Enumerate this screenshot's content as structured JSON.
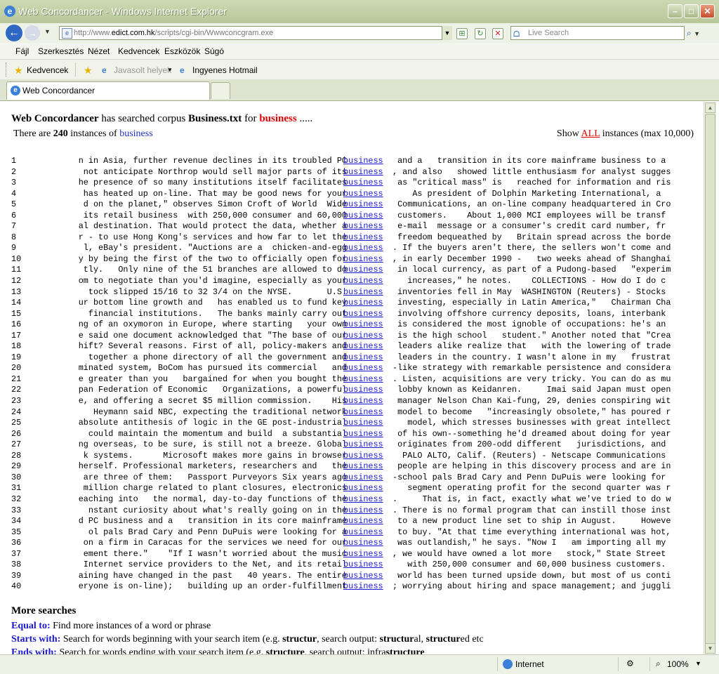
{
  "window": {
    "title": "Web Concordancer - Windows Internet Explorer"
  },
  "nav": {
    "url_prefix": "http://www.",
    "url_host": "edict.com.hk",
    "url_path": "/scripts/cgi-bin/Wwwconcgram.exe",
    "search_placeholder": "Live Search"
  },
  "menu": [
    "Fájl",
    "Szerkesztés",
    "Nézet",
    "Kedvencek",
    "Eszközök",
    "Súgó"
  ],
  "favorites": {
    "label": "Kedvencek",
    "suggested": "Javasolt helyek",
    "hotmail": "Ingyenes Hotmail"
  },
  "tab": {
    "label": "Web Concordancer"
  },
  "page": {
    "h_app": "Web Concordancer",
    "h_text1": " has searched corpus ",
    "h_corpus": "Business.txt",
    "h_text2": " for ",
    "h_term": "business",
    "h_dots": " .....",
    "count_pre": "There are ",
    "count_num": "240",
    "count_mid": " instances of ",
    "count_term": "business",
    "show_pre": "Show ",
    "show_all": "ALL",
    "show_post": " instances (max 10,000)"
  },
  "concordance": [
    {
      "n": "1",
      "left": "n in Asia, further revenue declines in its troubled PC",
      "kw": "business",
      "right": " and a   transition in its core mainframe business to a"
    },
    {
      "n": "2",
      "left": "not anticipate Northrop would sell major parts of its",
      "kw": "business",
      "right": ", and also   showed little enthusiasm for analyst sugges"
    },
    {
      "n": "3",
      "left": "he presence of so many institutions itself facilitates",
      "kw": "business",
      "right": " as \"critical mass\" is   reached for information and ris"
    },
    {
      "n": "4",
      "left": "has heated up on-line. That may be good news for your",
      "kw": "business",
      "right": "    As president of Dolphin Marketing International, a"
    },
    {
      "n": "5",
      "left": "d on the planet,\" observes Simon Croft of World  Wide",
      "kw": "business",
      "right": " Communications, an on-line company headquartered in Cro"
    },
    {
      "n": "6",
      "left": "its retail business  with 250,000 consumer and 60,000",
      "kw": "business",
      "right": " customers.    About 1,000 MCI employees will be transf"
    },
    {
      "n": "7",
      "left": "al destination. That would protect the data, whether a",
      "kw": "business",
      "right": " e-mail  message or a consumer's credit card number, fr"
    },
    {
      "n": "8",
      "left": "r - to use Hong Kong's services and how far to let the",
      "kw": "business",
      "right": " freedom bequeathed by   Britain spread across the borde"
    },
    {
      "n": "9",
      "left": "l, eBay's president. \"Auctions are a  chicken-and-egg",
      "kw": "business",
      "right": ". If the buyers aren't there, the sellers won't come and"
    },
    {
      "n": "10",
      "left": "y by being the first of the two to officially open for",
      "kw": "business",
      "right": ", in early December 1990 -   two weeks ahead of Shanghai"
    },
    {
      "n": "11",
      "left": "tly.   Only nine of the 51 branches are allowed to do",
      "kw": "business",
      "right": " in local currency, as part of a Pudong-based   \"experim"
    },
    {
      "n": "12",
      "left": "om to negotiate than you'd imagine, especially as your",
      "kw": "business",
      "right": "   increases,\" he notes.    COLLECTIONS - How do I do c"
    },
    {
      "n": "13",
      "left": "tock slipped 15/16 to 32 3/4 on the NYSE.       U.S.",
      "kw": "business",
      "right": " inventories fell in May  WASHINGTON (Reuters) - Stocks"
    },
    {
      "n": "14",
      "left": "ur bottom line growth and   has enabled us to fund key",
      "kw": "business",
      "right": " investing, especially in Latin America,\"   Chairman Cha"
    },
    {
      "n": "15",
      "left": "financial institutions.   The banks mainly carry out",
      "kw": "business",
      "right": " involving offshore currency deposits, loans, interbank"
    },
    {
      "n": "16",
      "left": "ng of an oxymoron in Europe, where starting   your own",
      "kw": "business",
      "right": " is considered the most ignoble of occupations: he's an"
    },
    {
      "n": "17",
      "left": "e said one document acknowledged that \"The base of our",
      "kw": "business",
      "right": " is the high school   student.\" Another noted that \"Crea"
    },
    {
      "n": "18",
      "left": "hift? Several reasons. First of all, policy-makers and",
      "kw": "business",
      "right": " leaders alike realize that   with the lowering of trade"
    },
    {
      "n": "19",
      "left": "together a phone directory of all the government and",
      "kw": "business",
      "right": " leaders in the country. I wasn't alone in my   frustrat"
    },
    {
      "n": "20",
      "left": "minated system, BoCom has pursued its commercial   and",
      "kw": "business",
      "right": "-like strategy with remarkable persistence and considera"
    },
    {
      "n": "21",
      "left": "e greater than you   bargained for when you bought the",
      "kw": "business",
      "right": ". Listen, acquisitions are very tricky. You can do as mu"
    },
    {
      "n": "22",
      "left": "pan Federation of Economic   Organizations, a powerful",
      "kw": "business",
      "right": " lobby known as Keidanren.     Imai said Japan must open"
    },
    {
      "n": "23",
      "left": "e, and offering a secret $5 million commission.    His",
      "kw": "business",
      "right": " manager Nelson Chan Kai-fung, 29, denies conspiring wit"
    },
    {
      "n": "24",
      "left": "Heymann said NBC, expecting the traditional network",
      "kw": "business",
      "right": " model to become   \"increasingly obsolete,\" has poured r"
    },
    {
      "n": "25",
      "left": "absolute antithesis of logic in the GE post-industrial",
      "kw": "business",
      "right": "   model, which stresses businesses with great intellect"
    },
    {
      "n": "26",
      "left": "could maintain the momentum and build  a substantial",
      "kw": "business",
      "right": " of his own--something he'd dreamed about doing for year"
    },
    {
      "n": "27",
      "left": "ng overseas, to be sure, is still not a breeze. Global",
      "kw": "business",
      "right": " originates from 200-odd different   jurisdictions, and"
    },
    {
      "n": "28",
      "left": "k systems.      Microsoft makes more gains in browser",
      "kw": "business",
      "right": "  PALO ALTO, Calif. (Reuters) - Netscape Communications"
    },
    {
      "n": "29",
      "left": "herself. Professional marketers, researchers and   the",
      "kw": "business",
      "right": " people are helping in this discovery process and are in"
    },
    {
      "n": "30",
      "left": "are three of them:   Passport Purveyors Six years ago",
      "kw": "business",
      "right": "-school pals Brad Cary and Penn DuPuis were looking for"
    },
    {
      "n": "31",
      "left": "million charge related to plant closures, electronics",
      "kw": "business",
      "right": "   segment operating profit for the second quarter was r"
    },
    {
      "n": "32",
      "left": "eaching into   the normal, day-to-day functions of the",
      "kw": "business",
      "right": ".     That is, in fact, exactly what we've tried to do w"
    },
    {
      "n": "33",
      "left": "nstant curiosity about what's really going on in the",
      "kw": "business",
      "right": ". There is no formal program that can instill those inst"
    },
    {
      "n": "34",
      "left": "d PC business and a   transition in its core mainframe",
      "kw": "business",
      "right": " to a new product line set to ship in August.     Howeve"
    },
    {
      "n": "35",
      "left": "ol pals Brad Cary and Penn DuPuis were looking for a",
      "kw": "business",
      "right": " to buy. \"At that time everything international was hot,"
    },
    {
      "n": "36",
      "left": "on a firm in Caracas for the services we need for our",
      "kw": "business",
      "right": " was outlandish,\" he says. \"Now I   am importing all my"
    },
    {
      "n": "37",
      "left": "ement there.\"    \"If I wasn't worried about the music",
      "kw": "business",
      "right": ", we would have owned a lot more   stock,\" State Street"
    },
    {
      "n": "38",
      "left": "Internet service providers to the Net, and its retail",
      "kw": "business",
      "right": "   with 250,000 consumer and 60,000 business customers."
    },
    {
      "n": "39",
      "left": "aining have changed in the past   40 years. The entire",
      "kw": "business",
      "right": " world has been turned upside down, but most of us conti"
    },
    {
      "n": "40",
      "left": "eryone is on-line);   building up an order-fulfillment",
      "kw": "business",
      "right": "; worrying about hiring and space management; and juggli"
    }
  ],
  "more": {
    "title": "More searches",
    "equal_label": "Equal to:",
    "equal_text": " Find more instances of a word or phrase",
    "starts_label": "Starts with:",
    "starts_text1": " Search for words beginning with your search item (e.g. ",
    "starts_b1": "structur",
    "starts_text2": ", search output: ",
    "starts_b2": "structur",
    "starts_text3": "al, ",
    "starts_b3": "structur",
    "starts_text4": "ed etc",
    "ends_label": "Ends with:",
    "ends_text1": " Search for words ending with your search item (e.g. ",
    "ends_b1": "structure",
    "ends_text2": ", search output: infra",
    "ends_b2": "structure"
  },
  "status": {
    "zone": "Internet",
    "zoom": "100%"
  },
  "colors": {
    "keyword": "#1a1acc",
    "term_red": "#e00000"
  }
}
